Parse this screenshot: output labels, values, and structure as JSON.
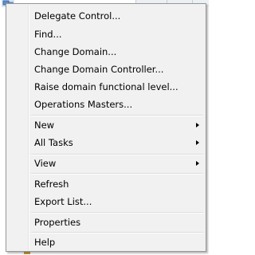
{
  "menu": {
    "groups": [
      {
        "items": [
          {
            "label": "Delegate Control..."
          },
          {
            "label": "Find..."
          },
          {
            "label": "Change Domain..."
          },
          {
            "label": "Change Domain Controller..."
          },
          {
            "label": "Raise domain functional level..."
          },
          {
            "label": "Operations Masters..."
          }
        ]
      },
      {
        "items": [
          {
            "label": "New",
            "submenu": true
          },
          {
            "label": "All Tasks",
            "submenu": true
          }
        ]
      },
      {
        "items": [
          {
            "label": "View",
            "submenu": true
          }
        ]
      },
      {
        "items": [
          {
            "label": "Refresh"
          },
          {
            "label": "Export List..."
          }
        ]
      },
      {
        "items": [
          {
            "label": "Properties"
          }
        ]
      },
      {
        "items": [
          {
            "label": "Help"
          }
        ]
      }
    ],
    "submenu_arrow_icon": "chevron-right-icon"
  },
  "colors": {
    "menu_background": "#f1f1f1",
    "menu_border": "#979797",
    "separator": "#dcdcdc",
    "text": "#000000"
  }
}
